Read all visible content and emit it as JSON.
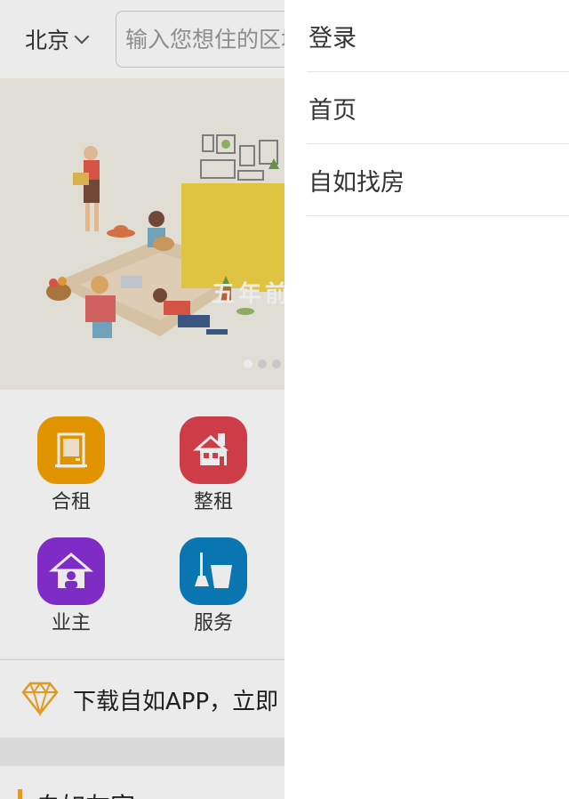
{
  "header": {
    "city": "北京",
    "search_placeholder": "输入您想住的区域或小区"
  },
  "banner": {
    "title": "五年前",
    "slide_count": 4,
    "active_slide": 0
  },
  "menu": [
    {
      "label": "合租",
      "icon": "door-icon",
      "color": "#f5a000"
    },
    {
      "label": "整租",
      "icon": "house-icon",
      "color": "#e0424e"
    },
    {
      "label": "业主",
      "icon": "owner-icon",
      "color": "#8a2fd6"
    },
    {
      "label": "服务",
      "icon": "cleaning-icon",
      "color": "#0a7fc0"
    }
  ],
  "promo": {
    "text": "下载自如APP，立即",
    "icon": "diamond-icon",
    "icon_color": "#f5a623"
  },
  "section": {
    "title": "自如友家",
    "accent": "#f5a623"
  },
  "drawer": {
    "items": [
      {
        "label": "登录"
      },
      {
        "label": "首页"
      },
      {
        "label": "自如找房"
      }
    ]
  }
}
